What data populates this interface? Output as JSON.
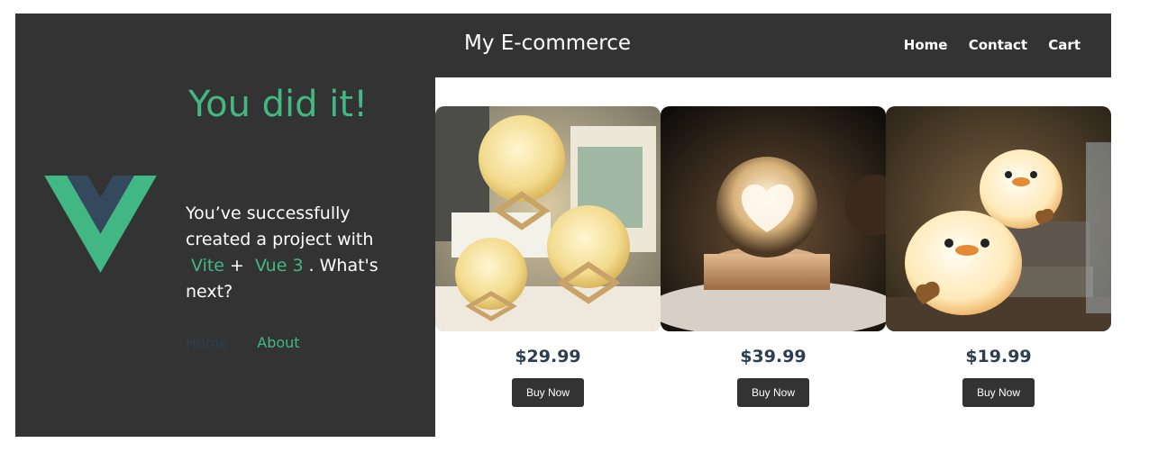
{
  "header": {
    "brand": "My E-commerce",
    "nav": [
      {
        "label": "Home"
      },
      {
        "label": "Contact"
      },
      {
        "label": "Cart"
      }
    ]
  },
  "hero": {
    "title": "You did it!",
    "line1": "You’ve successfully created a project with",
    "tool1": "Vite",
    "plus": "+",
    "tool2": "Vue 3",
    "period": ".",
    "line2": "What's next?"
  },
  "vue_nav": {
    "home": "Home",
    "about": "About"
  },
  "products": [
    {
      "image_icon": "moon-lamp-icon",
      "price": "$29.99",
      "button": "Buy Now"
    },
    {
      "image_icon": "crystal-ball-icon",
      "price": "$39.99",
      "button": "Buy Now"
    },
    {
      "image_icon": "duck-lamp-icon",
      "price": "$19.99",
      "button": "Buy Now"
    }
  ],
  "colors": {
    "dark": "#333333",
    "accent": "#42b883",
    "vue_dark": "#35495e",
    "price": "#2c3e50"
  }
}
